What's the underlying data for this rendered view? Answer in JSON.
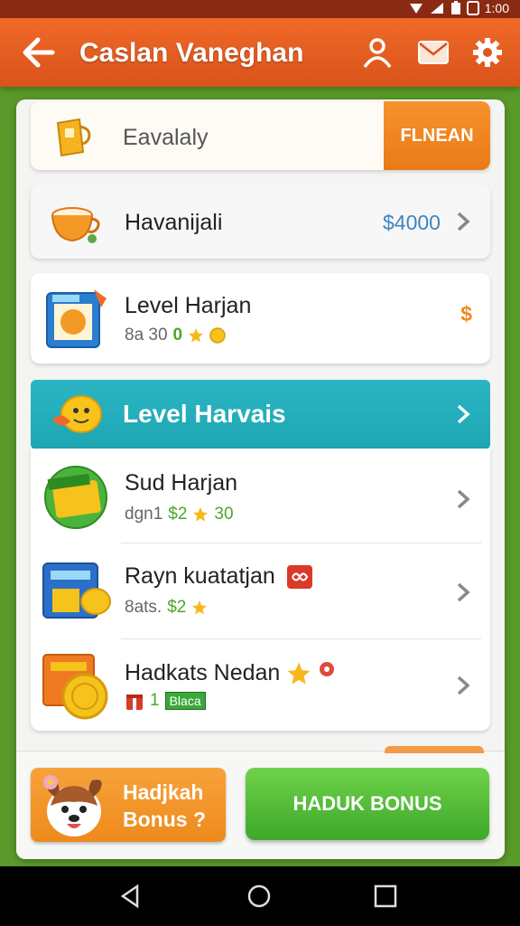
{
  "status_bar": {
    "time": "1:00"
  },
  "app_bar": {
    "title": "Caslan Vaneghan"
  },
  "search_card": {
    "placeholder": "Eavalaly",
    "button_label": "FLNEAN"
  },
  "items": [
    {
      "name": "Havanijali",
      "price": "$4000"
    },
    {
      "name": "Level Harjan",
      "sub_text": "8a 30",
      "sub_num": "0",
      "price": "$"
    },
    {
      "name": "Level Harvais"
    },
    {
      "name": "Sud Harjan",
      "sub_text": "dgn1",
      "sub_price": "$2",
      "sub_num": "30"
    },
    {
      "name": "Rayn kuatatjan",
      "sub_text": "8ats.",
      "sub_price": "$2"
    },
    {
      "name": "Hadkats Nedan",
      "sub_num": "1",
      "sub_badge": "Blaca"
    }
  ],
  "bottom": {
    "bonus_question": "Hadjkah Bonus ?",
    "bonus_button": "HADUK BONUS"
  },
  "colors": {
    "appbar": "#e85f22",
    "highlight": "#22aab7",
    "bonus_button": "#4cb832",
    "price": "#3a86c4"
  }
}
